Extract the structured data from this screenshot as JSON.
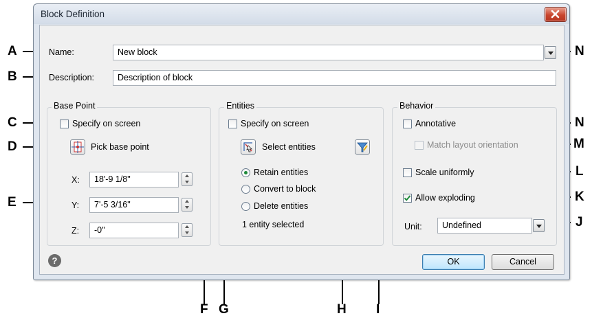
{
  "dialog": {
    "title": "Block Definition",
    "name_label": "Name:",
    "name_value": "New block",
    "description_label": "Description:",
    "description_value": "Description of block",
    "base_point": {
      "title": "Base Point",
      "specify_on_screen": "Specify on screen",
      "pick_base_point": "Pick base point",
      "x_label": "X:",
      "x_value": "18'-9 1/8\"",
      "y_label": "Y:",
      "y_value": "7'-5 3/16\"",
      "z_label": "Z:",
      "z_value": "-0\""
    },
    "entities": {
      "title": "Entities",
      "specify_on_screen": "Specify on screen",
      "select_entities": "Select entities",
      "retain_entities": "Retain entities",
      "convert_to_block": "Convert to block",
      "delete_entities": "Delete entities",
      "selected_count": "1 entity selected",
      "selected_option": "Retain entities"
    },
    "behavior": {
      "title": "Behavior",
      "annotative": "Annotative",
      "match_layout_orientation": "Match layout orientation",
      "scale_uniformly": "Scale uniformly",
      "allow_exploding": "Allow exploding",
      "allow_exploding_checked": true,
      "unit_label": "Unit:",
      "unit_value": "Undefined"
    },
    "ok_label": "OK",
    "cancel_label": "Cancel"
  },
  "callouts": {
    "A": "A",
    "B": "B",
    "C": "C",
    "D": "D",
    "E": "E",
    "F": "F",
    "G": "G",
    "H": "H",
    "I": "I",
    "J": "J",
    "K": "K",
    "L": "L",
    "M": "M",
    "N1": "N",
    "N2": "N"
  },
  "colors": {
    "callout_lines": "#000000",
    "close_button": "#c8452e",
    "check_mark": "#1d8a3a"
  }
}
